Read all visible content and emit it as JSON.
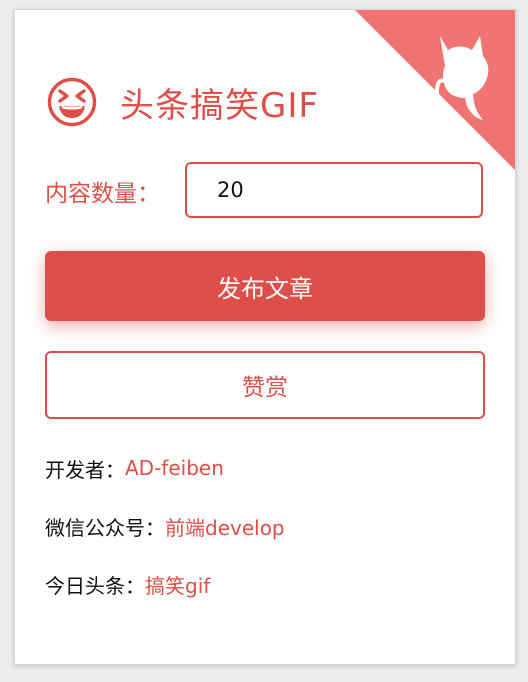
{
  "header": {
    "icon": "grinning-squint-emoji-icon",
    "title": "头条搞笑GIF"
  },
  "count": {
    "label": "内容数量：",
    "value": "20"
  },
  "buttons": {
    "publish": "发布文章",
    "reward": "赞赏"
  },
  "info": [
    {
      "label": "开发者：",
      "link": "AD-feiben"
    },
    {
      "label": "微信公众号：",
      "link": "前端develop"
    },
    {
      "label": "今日头条：",
      "link": "搞笑gif"
    }
  ],
  "corner": {
    "icon": "github-octocat-icon"
  },
  "colors": {
    "accent": "#dd4f48",
    "corner": "#f07472",
    "text": "#111111",
    "background": "#ffffff"
  }
}
